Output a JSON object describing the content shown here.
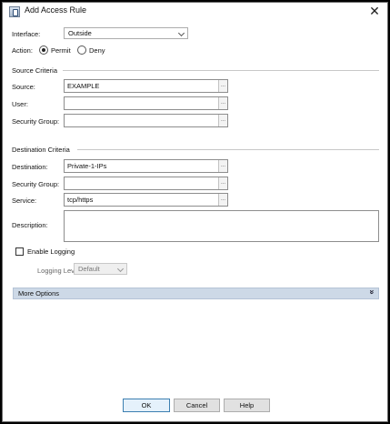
{
  "window": {
    "title": "Add Access Rule",
    "close_glyph": "✕"
  },
  "interface": {
    "label": "Interface:",
    "value": "Outside"
  },
  "action": {
    "label": "Action:",
    "permit": "Permit",
    "deny": "Deny",
    "selected": "Permit"
  },
  "source": {
    "section": "Source Criteria",
    "source_label": "Source:",
    "source_value": "EXAMPLE",
    "user_label": "User:",
    "user_value": "",
    "sg_label": "Security Group:",
    "sg_value": ""
  },
  "destination": {
    "section": "Destination Criteria",
    "dest_label": "Destination:",
    "dest_value": "Private-1-IPs",
    "sg_label": "Security Group:",
    "sg_value": "",
    "service_label": "Service:",
    "service_value": "tcp/https"
  },
  "description": {
    "label": "Description:",
    "value": ""
  },
  "logging": {
    "enable_label": "Enable Logging",
    "enabled": false,
    "level_label": "Logging Level:",
    "level_value": "Default"
  },
  "more_options": {
    "label": "More Options",
    "icon": "double-chevron-down"
  },
  "buttons": {
    "ok": "OK",
    "cancel": "Cancel",
    "help": "Help"
  },
  "browse_glyph": "...",
  "colors": {
    "more_options_bar": "#cdd9e7",
    "default_button_border": "#3c7fb1"
  }
}
